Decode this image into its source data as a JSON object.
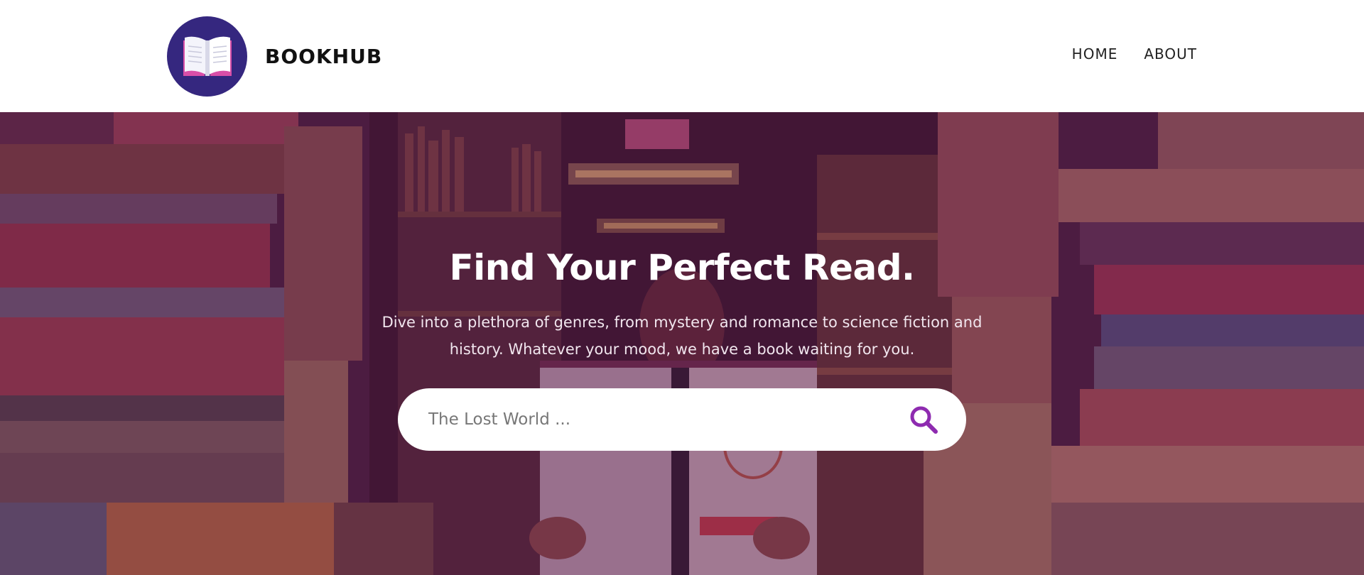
{
  "brand": {
    "name": "BOOKHUB",
    "logo_icon": "open-book-icon"
  },
  "nav": {
    "items": [
      {
        "label": "HOME"
      },
      {
        "label": "ABOUT"
      }
    ]
  },
  "hero": {
    "title": "Find Your Perfect Read.",
    "subtitle": "Dive into a plethora of genres, from mystery and romance to science fiction and history. Whatever your mood, we have a book waiting for you.",
    "background_icon": "bookstore-shelves-image"
  },
  "search": {
    "placeholder": "The Lost World ...",
    "value": "",
    "icon": "search-icon"
  },
  "colors": {
    "logo_background": "#35277f",
    "accent": "#8e2bb0",
    "overlay": "#5f1950"
  }
}
